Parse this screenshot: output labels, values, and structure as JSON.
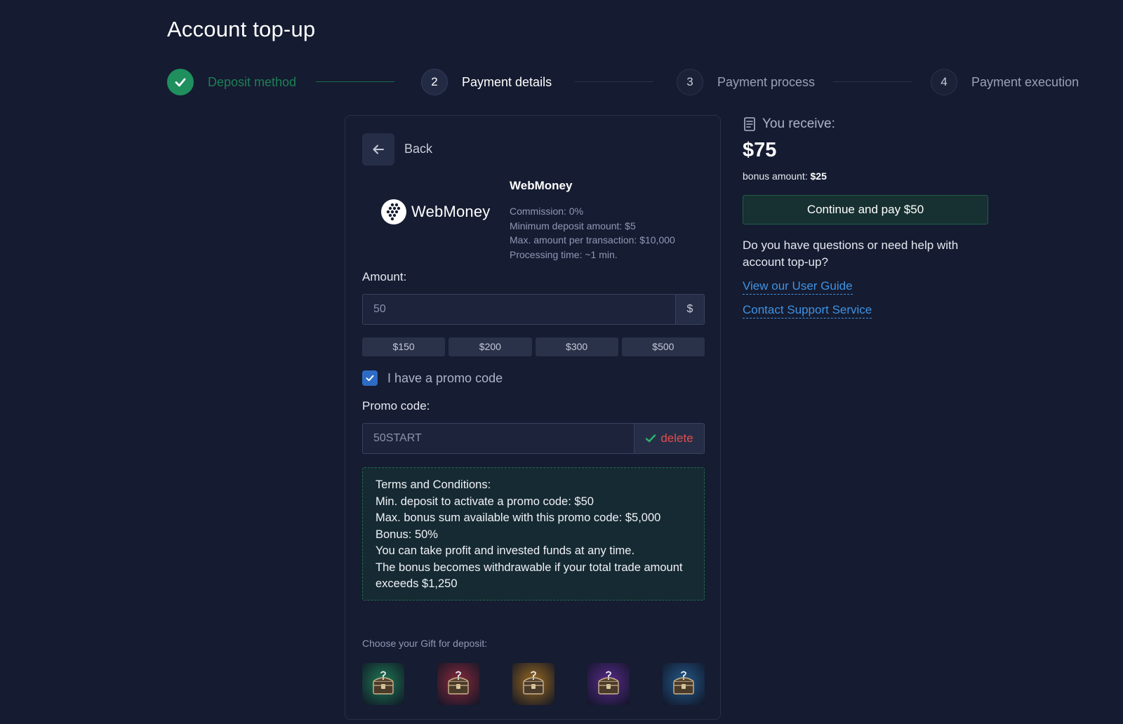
{
  "page": {
    "title": "Account top-up"
  },
  "stepper": {
    "steps": [
      {
        "number": "",
        "label": "Deposit method",
        "state": "done"
      },
      {
        "number": "2",
        "label": "Payment details",
        "state": "active"
      },
      {
        "number": "3",
        "label": "Payment process",
        "state": "pending"
      },
      {
        "number": "4",
        "label": "Payment execution",
        "state": "pending"
      }
    ]
  },
  "card": {
    "back_label": "Back",
    "method": {
      "logo_text": "WebMoney",
      "name": "WebMoney",
      "commission": "Commission: 0%",
      "min_deposit": "Minimum deposit amount: $5",
      "max_amount": "Max. amount per transaction: $10,000",
      "processing_time": "Processing time: ~1 min."
    },
    "amount": {
      "label": "Amount:",
      "value": "50",
      "currency": "$",
      "quick_amounts": [
        "$150",
        "$200",
        "$300",
        "$500"
      ]
    },
    "promo_checkbox": {
      "label": "I have a promo code",
      "checked": true
    },
    "promo": {
      "label": "Promo code:",
      "value": "50START",
      "delete_label": "delete"
    },
    "terms": {
      "title": "Terms and Conditions:",
      "lines": [
        "Min. deposit to activate a promo code: $50",
        "Max. bonus sum available with this promo code: $5,000",
        "Bonus: 50%",
        "You can take profit and invested funds at any time.",
        "The bonus becomes withdrawable if your total trade amount exceeds $1,250"
      ]
    },
    "gifts": {
      "title": "Choose your Gift for deposit:",
      "items": [
        {
          "name": "green-chest",
          "color": "#1f7a52"
        },
        {
          "name": "red-chest",
          "color": "#8a2a3a"
        },
        {
          "name": "gold-chest",
          "color": "#9a6a1e"
        },
        {
          "name": "purple-chest",
          "color": "#5a2a8a"
        },
        {
          "name": "blue-chest",
          "color": "#245a8a"
        }
      ]
    }
  },
  "summary": {
    "receive_label": "You receive:",
    "receive_amount": "$75",
    "bonus_label": "bonus amount:",
    "bonus_value": "$25",
    "continue_label": "Continue and pay $50",
    "help_text": "Do you have questions or need help with account top-up?",
    "guide_link": "View our User Guide",
    "support_link": "Contact Support Service"
  },
  "colors": {
    "background": "#151b30",
    "success": "#1f8f5e",
    "link": "#3f93e4",
    "danger": "#e34c4c",
    "checkbox": "#2d6cc4"
  }
}
